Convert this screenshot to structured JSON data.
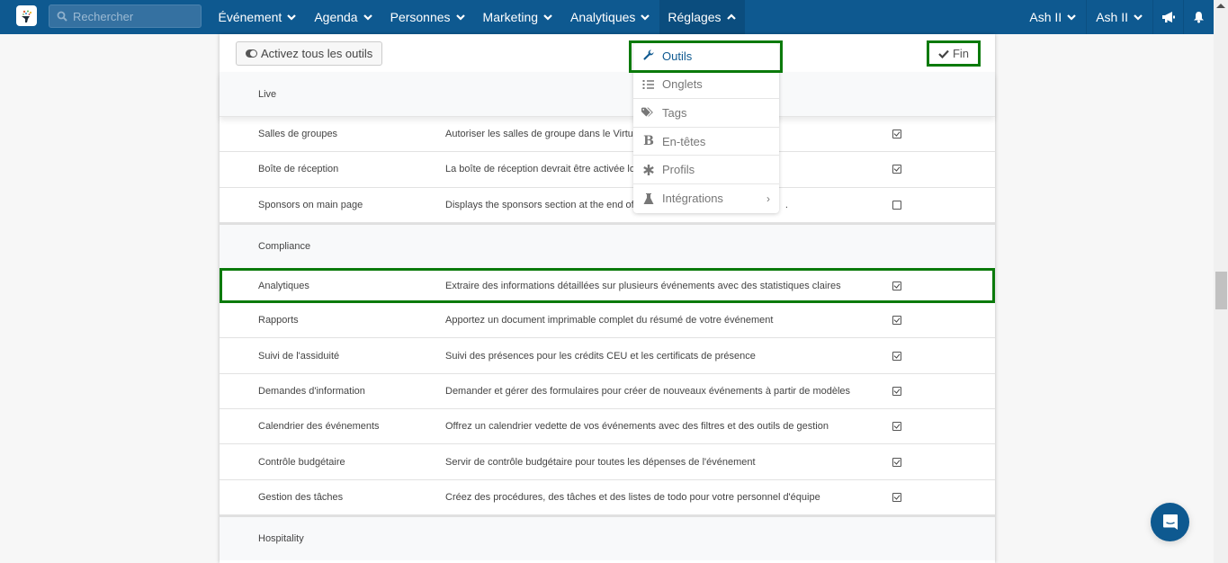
{
  "header": {
    "logo": "event-logo",
    "search_placeholder": "Rechercher",
    "nav": [
      {
        "label": "Événement",
        "icon": "chevron-down-icon"
      },
      {
        "label": "Agenda",
        "icon": "chevron-down-icon"
      },
      {
        "label": "Personnes",
        "icon": "chevron-down-icon"
      },
      {
        "label": "Marketing",
        "icon": "chevron-down-icon"
      },
      {
        "label": "Analytiques",
        "icon": "chevron-down-icon"
      },
      {
        "label": "Réglages",
        "icon": "chevron-up-icon",
        "active": true
      }
    ],
    "user_menus": [
      {
        "label": "Ash II"
      },
      {
        "label": "Ash II"
      }
    ],
    "icons": [
      "megaphone-icon",
      "bell-icon"
    ]
  },
  "toolbar": {
    "activate_all_label": "Activez tous les outils",
    "done_label": "Fin"
  },
  "settings_menu": {
    "items": [
      {
        "label": "Outils",
        "icon": "wrench-icon",
        "active": true
      },
      {
        "label": "Onglets",
        "icon": "list-icon"
      },
      {
        "label": "Tags",
        "icon": "tags-icon"
      },
      {
        "label": "En-têtes",
        "icon": "bold-icon"
      },
      {
        "label": "Profils",
        "icon": "asterisk-icon"
      },
      {
        "label": "Intégrations",
        "icon": "flask-icon",
        "submenu": "›"
      }
    ]
  },
  "sections": [
    {
      "title": "Live",
      "rows": [
        {
          "name": "Salles de groupes",
          "description": "Autoriser les salles de groupe dans le Virtual",
          "enabled": true
        },
        {
          "name": "Boîte de réception",
          "description": "La boîte de réception devrait être activée lor",
          "enabled": true
        },
        {
          "name": "Sponsors on main page",
          "description": "Displays the sponsors section at the end of t",
          "description_tail": ".",
          "enabled": false
        }
      ]
    },
    {
      "title": "Compliance",
      "rows": [
        {
          "name": "Analytiques",
          "description": "Extraire des informations détaillées sur plusieurs événements avec des statistiques claires",
          "enabled": true,
          "highlighted": true
        },
        {
          "name": "Rapports",
          "description": "Apportez un document imprimable complet du résumé de votre événement",
          "enabled": true
        },
        {
          "name": "Suivi de l'assiduité",
          "description": "Suivi des présences pour les crédits CEU et les certificats de présence",
          "enabled": true
        },
        {
          "name": "Demandes d'information",
          "description": "Demander et gérer des formulaires pour créer de nouveaux événements à partir de modèles",
          "enabled": true
        },
        {
          "name": "Calendrier des événements",
          "description": "Offrez un calendrier vedette de vos événements avec des filtres et des outils de gestion",
          "enabled": true
        },
        {
          "name": "Contrôle budgétaire",
          "description": "Servir de contrôle budgétaire pour toutes les dépenses de l'événement",
          "enabled": true
        },
        {
          "name": "Gestion des tâches",
          "description": "Créez des procédures, des tâches et des listes de todo pour votre personnel d'équipe",
          "enabled": true
        }
      ]
    },
    {
      "title": "Hospitality",
      "rows": []
    }
  ],
  "colors": {
    "brand": "#0e5990",
    "highlight": "#0b7a0b"
  }
}
